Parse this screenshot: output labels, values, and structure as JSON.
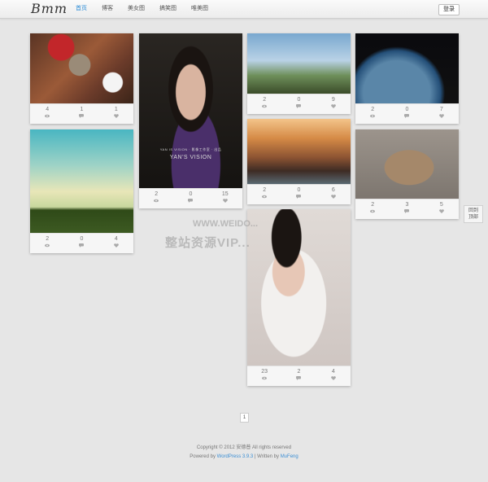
{
  "header": {
    "logo": "Bmm",
    "nav": [
      "首页",
      "博客",
      "美女图",
      "搞笑图",
      "唯美图"
    ],
    "login": "登录"
  },
  "cards": [
    {
      "likes": "4",
      "comments": "1",
      "hearts": "1"
    },
    {
      "likes": "2",
      "comments": "0",
      "hearts": "4"
    },
    {
      "likes": "2",
      "comments": "0",
      "hearts": "15",
      "caption_small": "YAN IS VISION · 影像工作室 · 出品",
      "caption_big": "YAN'S VISION"
    },
    {
      "likes": "2",
      "comments": "0",
      "hearts": "9"
    },
    {
      "likes": "2",
      "comments": "0",
      "hearts": "6"
    },
    {
      "likes": "23",
      "comments": "2",
      "hearts": "4"
    },
    {
      "likes": "2",
      "comments": "0",
      "hearts": "7"
    },
    {
      "likes": "2",
      "comments": "3",
      "hearts": "5"
    }
  ],
  "back_to_top": [
    "回到",
    "顶部"
  ],
  "watermark": {
    "url": "WWW.WEIDO...",
    "cn": "整站资源VIP..."
  },
  "pager": "1",
  "footer": {
    "copyright": "Copyright © 2012 安德普 All rights reserved",
    "powered_prefix": "Powered by",
    "powered_link": "WordPress 3.9.3",
    "written_prefix": "| Written by",
    "written_link": "MuFeng"
  }
}
